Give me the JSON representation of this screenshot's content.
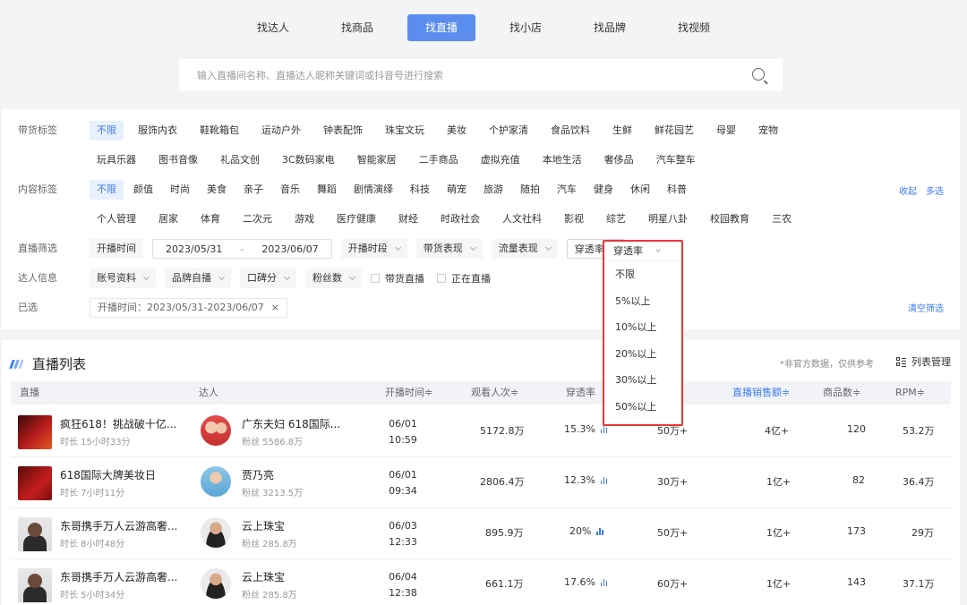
{
  "tabs": [
    {
      "label": "找达人"
    },
    {
      "label": "找商品"
    },
    {
      "label": "找直播"
    },
    {
      "label": "找小店"
    },
    {
      "label": "找品牌"
    },
    {
      "label": "找视频"
    }
  ],
  "search": {
    "placeholder": "输入直播间名称、直播达人昵称关键词或抖音号进行搜索"
  },
  "filters": {
    "goods_label": "带货标签",
    "goods_row1": [
      "不限",
      "服饰内衣",
      "鞋靴箱包",
      "运动户外",
      "钟表配饰",
      "珠宝文玩",
      "美妆",
      "个护家清",
      "食品饮料",
      "生鲜",
      "鲜花园艺",
      "母婴",
      "宠物"
    ],
    "goods_row2": [
      "玩具乐器",
      "图书音像",
      "礼品文创",
      "3C数码家电",
      "智能家居",
      "二手商品",
      "虚拟充值",
      "本地生活",
      "奢侈品",
      "汽车整车"
    ],
    "content_label": "内容标签",
    "content_row1": [
      "不限",
      "颜值",
      "时尚",
      "美食",
      "亲子",
      "音乐",
      "舞蹈",
      "剧情演绎",
      "科技",
      "萌宠",
      "旅游",
      "随拍",
      "汽车",
      "健身",
      "休闲",
      "科普"
    ],
    "content_row2": [
      "个人管理",
      "居家",
      "体育",
      "二次元",
      "游戏",
      "医疗健康",
      "财经",
      "时政社会",
      "人文社科",
      "影视",
      "综艺",
      "明星八卦",
      "校园教育",
      "三农"
    ],
    "collapse": "收起",
    "multi": "多选",
    "live_label": "直播筛选",
    "live_time_label": "开播时间",
    "date_start": "2023/05/31",
    "date_sep": "-",
    "date_end": "2023/06/07",
    "live_slot": "开播时段",
    "goods_perf": "带货表现",
    "traffic_perf": "流量表现",
    "penetration": "穿透率",
    "talent_label": "达人信息",
    "account": "账号资料",
    "brand_live": "品牌自播",
    "talk": "口碑分",
    "fans": "粉丝数",
    "check_goods_live": "带货直播",
    "check_living": "正在直播",
    "selected_label": "已选",
    "selected_tag": "开播时间：2023/05/31-2023/06/07",
    "selected_close": "×",
    "clear": "清空筛选"
  },
  "dropdown": {
    "title": "穿透率",
    "options": [
      "不限",
      "5%以上",
      "10%以上",
      "20%以上",
      "30%以上",
      "50%以上"
    ]
  },
  "list": {
    "title": "直播列表",
    "note": "*非官方数据，仅供参考",
    "manage": "列表管理",
    "headers": {
      "live": "直播",
      "talent": "达人",
      "start": "开播时间≑",
      "viewers": "观看人次≑",
      "penetration": "穿透率",
      "sales": "直播销售额≑",
      "goods": "商品数≑",
      "rpm": "RPM≑"
    },
    "rows": [
      {
        "title": "疯狂618！挑战破十亿...",
        "duration": "时长 15小时33分",
        "talent": "广东夫妇 618国际...",
        "fans": "粉丝 5586.8万",
        "date": "06/01",
        "time": "10:59",
        "viewers": "5172.8万",
        "penetration": "15.3%",
        "col": "50万+",
        "sales": "4亿+",
        "goods": "120",
        "rpm": "53.2万"
      },
      {
        "title": "618国际大牌美妆日",
        "duration": "时长 7小时11分",
        "talent": "贾乃亮",
        "fans": "粉丝 3213.5万",
        "date": "06/01",
        "time": "09:34",
        "viewers": "2806.4万",
        "penetration": "12.3%",
        "col": "30万+",
        "sales": "1亿+",
        "goods": "82",
        "rpm": "36.4万"
      },
      {
        "title": "东哥携手万人云游高奢...",
        "duration": "时长 8小时48分",
        "talent": "云上珠宝",
        "fans": "粉丝 285.8万",
        "date": "06/03",
        "time": "12:33",
        "viewers": "895.9万",
        "penetration": "20%",
        "col": "50万+",
        "sales": "1亿+",
        "goods": "173",
        "rpm": "29万"
      },
      {
        "title": "东哥携手万人云游高奢...",
        "duration": "时长 5小时34分",
        "talent": "云上珠宝",
        "fans": "粉丝 285.8万",
        "date": "06/04",
        "time": "12:38",
        "viewers": "661.1万",
        "penetration": "17.6%",
        "col": "60万+",
        "sales": "1亿+",
        "goods": "143",
        "rpm": "37.1万"
      }
    ]
  },
  "colors": {
    "accent": "#3a7bf2",
    "tab_active": "#5b8def",
    "highlight_border": "#e53935"
  }
}
